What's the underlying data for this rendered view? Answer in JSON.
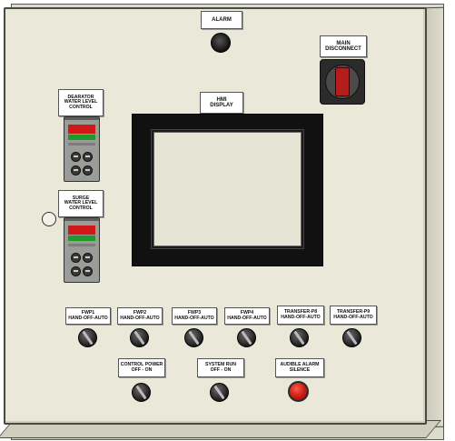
{
  "panel": {
    "alarm": {
      "label": "ALARM"
    },
    "main_disconnect": {
      "line1": "MAIN",
      "line2": "DISCONNECT"
    },
    "hmi": {
      "line1": "HMI",
      "line2": "DISPLAY"
    },
    "deaerator": {
      "line1": "DEARATOR",
      "line2": "WATER LEVEL",
      "line3": "CONTROL"
    },
    "surge": {
      "line1": "SURGE",
      "line2": "WATER LEVEL",
      "line3": "CONTROL"
    },
    "switches": [
      {
        "name": "FWP1",
        "mode": "HAND-OFF-AUTO"
      },
      {
        "name": "FWP2",
        "mode": "HAND-OFF-AUTO"
      },
      {
        "name": "FWP3",
        "mode": "HAND-OFF-AUTO"
      },
      {
        "name": "FWP4",
        "mode": "HAND-OFF-AUTO"
      },
      {
        "name": "TRANSFER-P8",
        "mode": "HAND-OFF-AUTO"
      },
      {
        "name": "TRANSFER-P9",
        "mode": "HAND-OFF-AUTO"
      }
    ],
    "control_power": {
      "line1": "CONTROL POWER",
      "line2": "OFF  -  ON"
    },
    "system_run": {
      "line1": "SYSTEM RUN",
      "line2": "OFF  -  ON"
    },
    "audible_alarm": {
      "line1": "AUDIBLE ALARM",
      "line2": "SILENCE"
    }
  },
  "colors": {
    "panel": "#e9e8d9",
    "display_red": "#d01818",
    "display_green": "#1e9a2a",
    "disconnect_handle": "#b51c1c",
    "pushbutton": "#c81a12"
  },
  "icons": {
    "alarm_light": "alarm-light-icon",
    "disconnect": "disconnect-switch-icon"
  }
}
